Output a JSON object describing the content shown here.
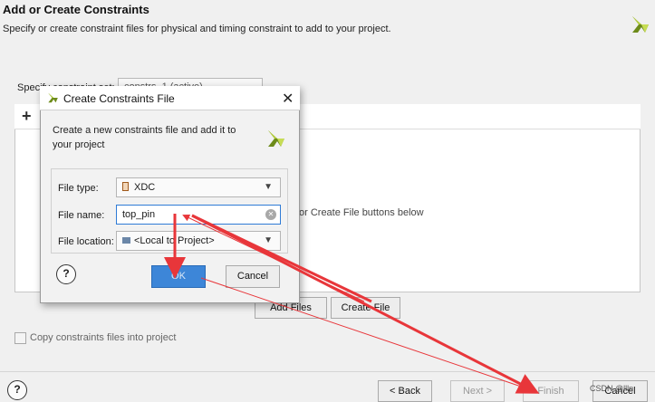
{
  "header": {
    "title": "Add or Create Constraints",
    "description": "Specify or create constraint files for physical and timing constraint to add to your project."
  },
  "constraint_set": {
    "label": "Specify constraint set:",
    "value": "constrs_1 (active)"
  },
  "file_panel": {
    "add_icon": "+",
    "hint": "or Create File buttons below",
    "add_files_label": "Add Files",
    "create_file_label": "Create File"
  },
  "copy_option": {
    "label": "Copy constraints files into project",
    "checked": false
  },
  "wizard_buttons": {
    "help": "?",
    "back": "< Back",
    "next": "Next >",
    "finish": "Finish",
    "cancel": "Cancel"
  },
  "dialog": {
    "title": "Create Constraints File",
    "close": "✕",
    "description": "Create a new constraints file and add it to your project",
    "file_type_label": "File type:",
    "file_type_value": "XDC",
    "file_name_label": "File name:",
    "file_name_value": "top_pin",
    "file_location_label": "File location:",
    "file_location_value": "<Local to Project>",
    "help": "?",
    "ok": "OK",
    "cancel": "Cancel"
  },
  "watermark": "CSDN @llln",
  "colors": {
    "annotation": "#e8363a",
    "brand_light": "#b5cf3a",
    "brand_dark": "#6d8b1a",
    "ok_blue": "#3d86d8"
  },
  "icons": [
    "brand-logo-icon",
    "add-icon",
    "close-icon",
    "help-icon",
    "chevron-down-icon",
    "xdc-file-icon",
    "folder-icon",
    "clear-icon"
  ]
}
